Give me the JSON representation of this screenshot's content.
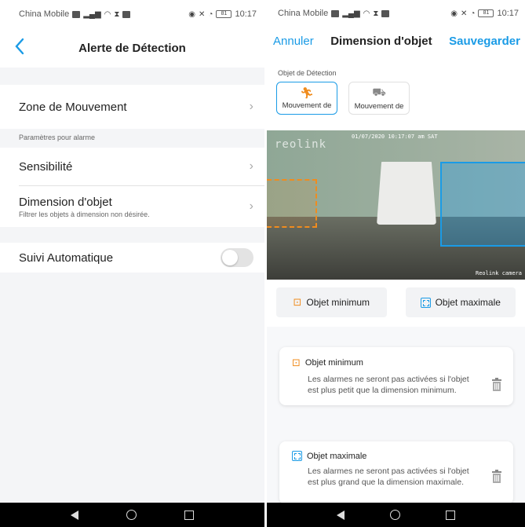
{
  "status_bar": {
    "carrier": "China Mobile",
    "signal_label": "4G",
    "battery": "81",
    "time": "10:17"
  },
  "left": {
    "title": "Alerte de Détection",
    "motion_zone": "Zone de Mouvement",
    "alarm_settings_label": "Paramètres pour alarme",
    "sensitivity": "Sensibilité",
    "object_size": "Dimension d'objet",
    "object_size_desc": "Filtrer les objets à dimension non désirée.",
    "auto_tracking": "Suivi Automatique",
    "auto_tracking_on": false
  },
  "right": {
    "cancel": "Annuler",
    "title": "Dimension d'objet",
    "save": "Sauvegarder",
    "detection_label": "Objet de Détection",
    "detection_cards": [
      {
        "label": "Mouvement de",
        "icon": "person-running-icon",
        "active": true
      },
      {
        "label": "Mouvement de",
        "icon": "car-icon",
        "active": false
      }
    ],
    "camera": {
      "logo": "reolink",
      "timestamp": "01/07/2020 10:17:07 am SAT",
      "camera_name": "Reolink camera"
    },
    "min_button": "Objet minimum",
    "max_button": "Objet maximale",
    "min_card": {
      "title": "Objet minimum",
      "text": "Les alarmes ne seront pas activées si l'objet est plus petit que la dimension minimum."
    },
    "max_card": {
      "title": "Objet maximale",
      "text": "Les alarmes ne seront pas activées si l'objet est plus grand que la dimension maximale."
    }
  },
  "colors": {
    "accent_blue": "#1a9be6",
    "accent_orange": "#f08c1e"
  }
}
